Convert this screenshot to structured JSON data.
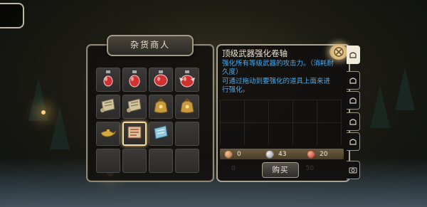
{
  "shop": {
    "title": "杂货商人",
    "items": [
      {
        "name": "red-potion-small-icon",
        "color": "#d0322f"
      },
      {
        "name": "red-potion-medium-icon",
        "color": "#d0322f"
      },
      {
        "name": "red-potion-large-icon",
        "color": "#d0322f"
      },
      {
        "name": "red-potion-winged-icon",
        "color": "#d0322f"
      },
      {
        "name": "scroll-icon",
        "color": "#cfc49a"
      },
      {
        "name": "scroll-icon",
        "color": "#cfc49a"
      },
      {
        "name": "gold-bag-icon",
        "color": "#c99a3c"
      },
      {
        "name": "gold-bag-icon",
        "color": "#c99a3c"
      },
      {
        "name": "magic-lamp-icon",
        "color": "#d8a93d"
      },
      {
        "name": "enhance-scroll-icon",
        "color": "#d6c7a0"
      },
      {
        "name": "blue-scroll-icon",
        "color": "#8fc6e0"
      },
      {
        "name": "empty-slot",
        "color": ""
      },
      {
        "name": "empty-slot",
        "color": ""
      },
      {
        "name": "empty-slot",
        "color": ""
      },
      {
        "name": "empty-slot",
        "color": ""
      },
      {
        "name": "empty-slot",
        "color": ""
      }
    ],
    "selected_index": 9
  },
  "detail": {
    "title": "顶级武器强化卷轴",
    "desc1": "强化所有等级武器的攻击力。（消耗耐久度）",
    "desc2": "可通过拖动到要强化的道具上面来进行强化。",
    "prices": [
      {
        "currency": "copper-coin-icon",
        "value": "0"
      },
      {
        "currency": "silver-coin-icon",
        "value": "43"
      },
      {
        "currency": "ruby-coin-icon",
        "value": "20"
      }
    ],
    "ghost_prices": [
      "0",
      "50"
    ],
    "buy_label": "购买"
  },
  "side_tabs": [
    "bag-icon",
    "bag-icon",
    "bag-icon",
    "bag-icon",
    "bag-icon",
    "camera-icon"
  ]
}
